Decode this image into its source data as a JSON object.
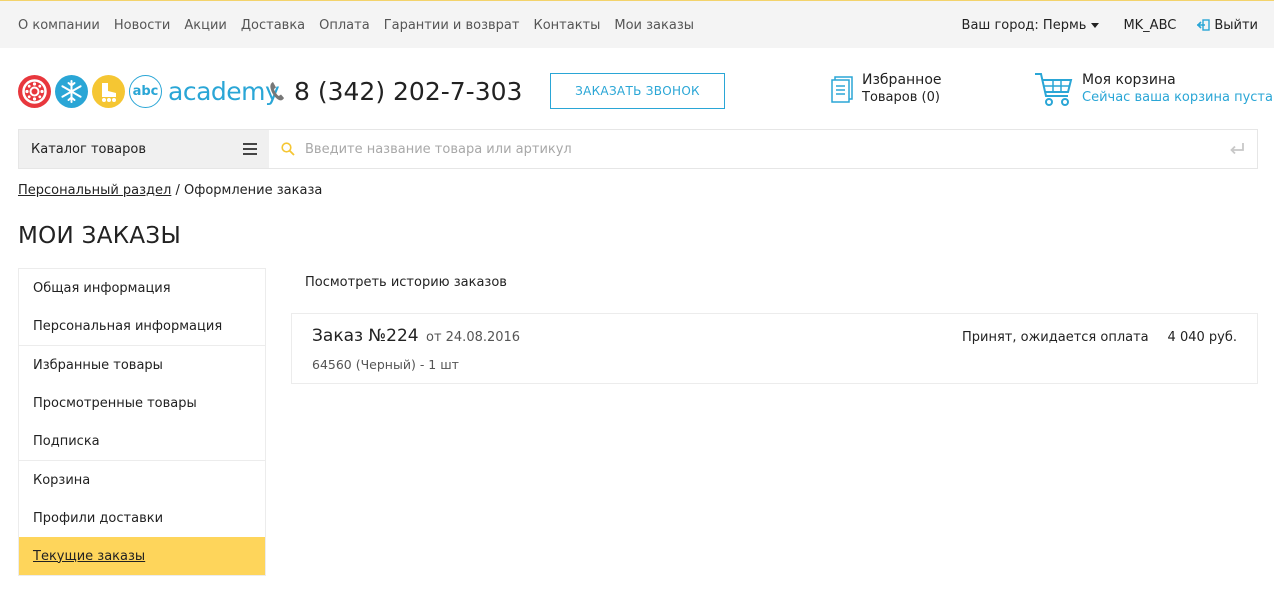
{
  "topnav": {
    "items": [
      "О компании",
      "Новости",
      "Акции",
      "Доставка",
      "Оплата",
      "Гарантии и возврат",
      "Контакты",
      "Мои заказы"
    ]
  },
  "topbar_right": {
    "city": "Ваш город: Пермь",
    "user": "MK_ABC",
    "logout": "Выйти"
  },
  "header": {
    "brand": "academy",
    "logo_icons": [
      "wheel-logo-icon",
      "snowflake-logo-icon",
      "rollerskate-logo-icon",
      "abc-logo-icon"
    ],
    "logo_colors": [
      "#e8373d",
      "#2aa6d6",
      "#f5c633",
      "#2aa6d6"
    ],
    "abc_text": "abc",
    "phone": "8 (342) 202-7-303",
    "call_button": "ЗАКАЗАТЬ ЗВОНОК",
    "favorites_title": "Избранное",
    "favorites_count": "Товаров (0)",
    "cart_title": "Моя корзина",
    "cart_status": "Сейчас ваша корзина пуста"
  },
  "search": {
    "catalog_label": "Каталог товаров",
    "placeholder": "Введите название товара или артикул"
  },
  "breadcrumb": {
    "link": "Персональный раздел",
    "separator": " / ",
    "current": "Оформление заказа"
  },
  "page_title": "МОИ ЗАКАЗЫ",
  "sidebar": {
    "groups": [
      [
        "Общая информация",
        "Персональная информация"
      ],
      [
        "Избранные товары",
        "Просмотренные товары",
        "Подписка"
      ],
      [
        "Корзина",
        "Профили доставки",
        "Текущие заказы"
      ]
    ],
    "active": "Текущие заказы"
  },
  "main": {
    "history_link": "Посмотреть историю заказов",
    "order": {
      "title": "Заказ №224",
      "date": "от 24.08.2016",
      "items": "64560 (Черный) - 1 шт",
      "status": "Принят, ожидается оплата",
      "sum": "4 040 руб."
    }
  },
  "colors": {
    "accent_blue": "#2aa6d6",
    "active_yellow": "#fed55b",
    "topbar_bg": "#f4f4f4"
  }
}
